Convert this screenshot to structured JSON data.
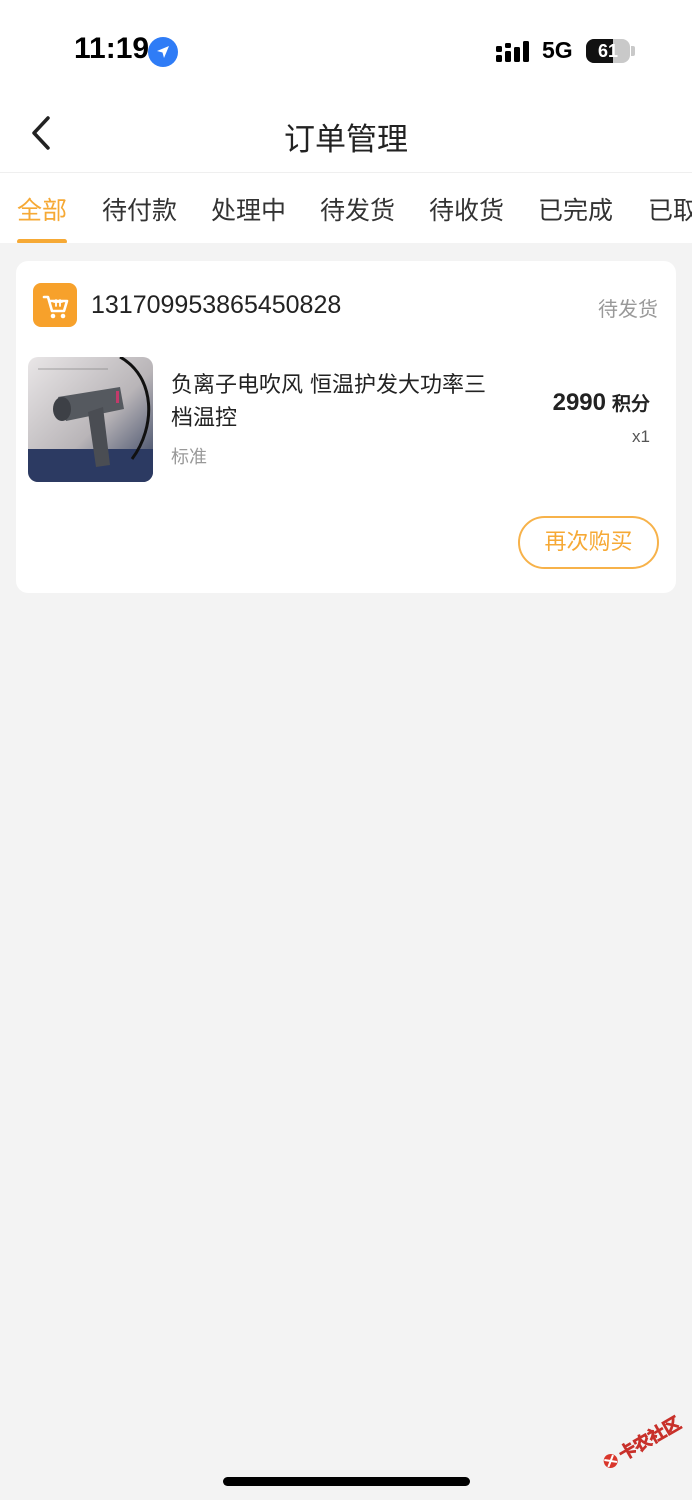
{
  "status_bar": {
    "time": "11:19",
    "network": "5G",
    "battery": "61",
    "battery_level": 0.61,
    "icons": [
      "location-arrow-icon",
      "signal-bars-icon",
      "battery-icon"
    ]
  },
  "nav": {
    "title": "订单管理",
    "back_icon": "chevron-left-icon"
  },
  "tabs": [
    {
      "label": "全部",
      "active": true
    },
    {
      "label": "待付款",
      "active": false
    },
    {
      "label": "处理中",
      "active": false
    },
    {
      "label": "待发货",
      "active": false
    },
    {
      "label": "待收货",
      "active": false
    },
    {
      "label": "已完成",
      "active": false
    },
    {
      "label": "已取消",
      "active": false
    }
  ],
  "order": {
    "shop_icon": "shopping-cart-icon",
    "number": "131709953865450828",
    "status": "待发货",
    "product": {
      "name": "负离子电吹风 恒温护发大功率三档温控",
      "spec": "标准",
      "price": "2990",
      "price_unit": "积分",
      "quantity": "x1",
      "image": "hair-dryer-product-image"
    },
    "rebuy_label": "再次购买"
  },
  "watermark": {
    "text": "卡农社区"
  },
  "colors": {
    "accent": "#f6a935",
    "page_bg": "#f3f3f3",
    "card_bg": "#ffffff",
    "muted_text": "#999999",
    "location_blue": "#2f7cf6"
  }
}
